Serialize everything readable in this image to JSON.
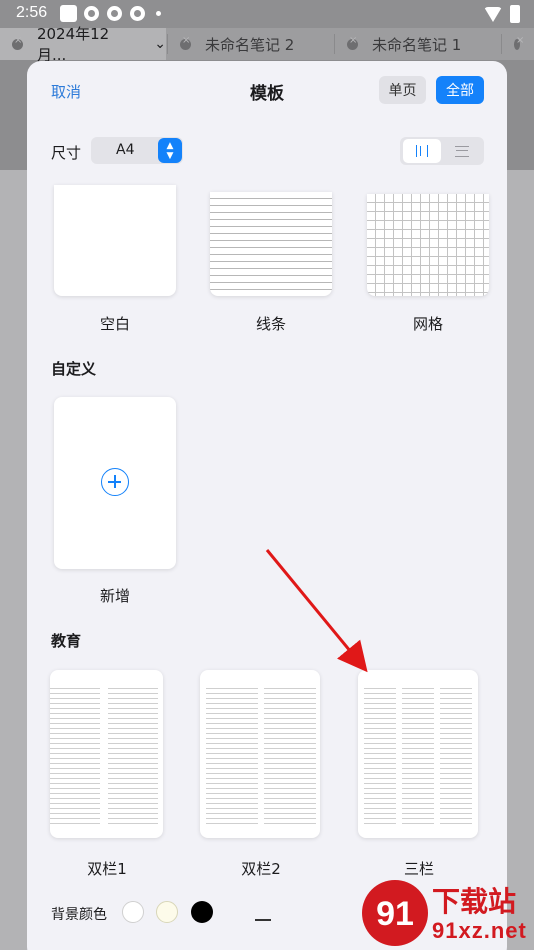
{
  "status_bar": {
    "time": "2:56"
  },
  "tabs": [
    {
      "label": "2024年12月...",
      "active": true
    },
    {
      "label": "未命名笔记 2",
      "active": false
    },
    {
      "label": "未命名笔记 1",
      "active": false
    }
  ],
  "modal": {
    "cancel_label": "取消",
    "title": "模板",
    "single_page_label": "单页",
    "all_label": "全部",
    "size_label": "尺寸",
    "size_value": "A4",
    "orientation_selected": "portrait"
  },
  "templates": {
    "basic": [
      {
        "label": "空白",
        "style": "blank"
      },
      {
        "label": "线条",
        "style": "lines"
      },
      {
        "label": "网格",
        "style": "grid"
      }
    ],
    "custom_title": "自定义",
    "custom": [
      {
        "label": "新增",
        "style": "add"
      }
    ],
    "education_title": "教育",
    "education": [
      {
        "label": "双栏1",
        "style": "two-column"
      },
      {
        "label": "双栏2",
        "style": "two-column"
      },
      {
        "label": "三栏",
        "style": "three-column"
      }
    ]
  },
  "footer": {
    "background_color_label": "背景颜色",
    "colors": [
      "#ffffff",
      "#fdfbea",
      "#000000"
    ]
  },
  "watermark": {
    "text1": "下载站",
    "text2": "91xz.net",
    "badge": "91"
  },
  "colors": {
    "accent": "#1482fa",
    "arrow": "#e01818"
  }
}
